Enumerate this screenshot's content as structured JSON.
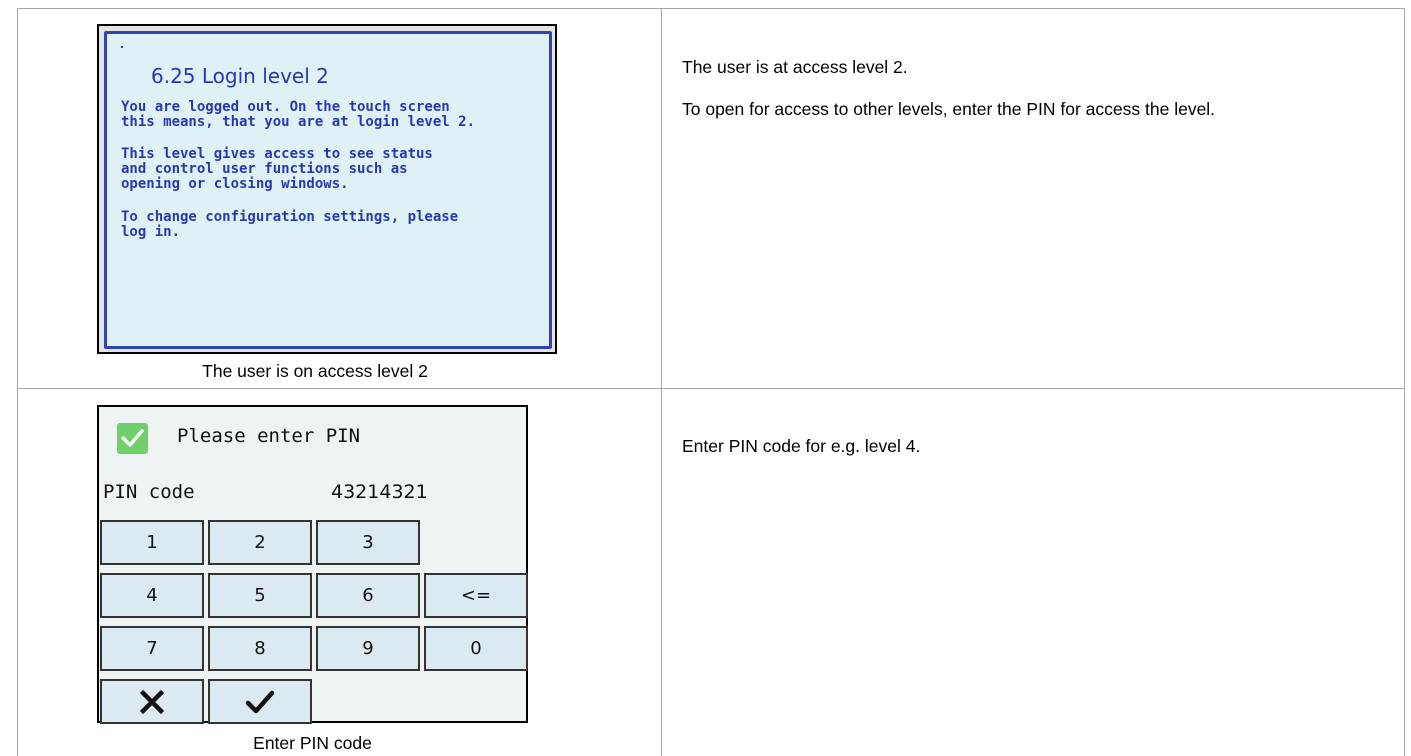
{
  "row1": {
    "screen": {
      "title": "6.25 Login level 2",
      "paragraphs": [
        "You are logged out. On the touch screen\nthis means, that you are at login level 2.",
        "This level gives access to see status\nand control user functions such as\nopening or closing windows.",
        "To change configuration settings, please\nlog in."
      ]
    },
    "caption": "The user is on access level 2",
    "description": [
      "The user is at access level 2.",
      "To open for access to other levels, enter the PIN for access the level."
    ]
  },
  "row2": {
    "screen": {
      "title": "Please enter PIN",
      "pin_label": "PIN code",
      "pin_value": "43214321",
      "keys": [
        "1",
        "2",
        "3",
        "4",
        "5",
        "6",
        "<=",
        "7",
        "8",
        "9",
        "0"
      ],
      "cancel_icon": "close-icon",
      "confirm_icon": "checkmark-icon",
      "accent_color": "#6fcf6a"
    },
    "caption": "Enter PIN code",
    "description": [
      "Enter PIN code for e.g. level 4."
    ]
  }
}
